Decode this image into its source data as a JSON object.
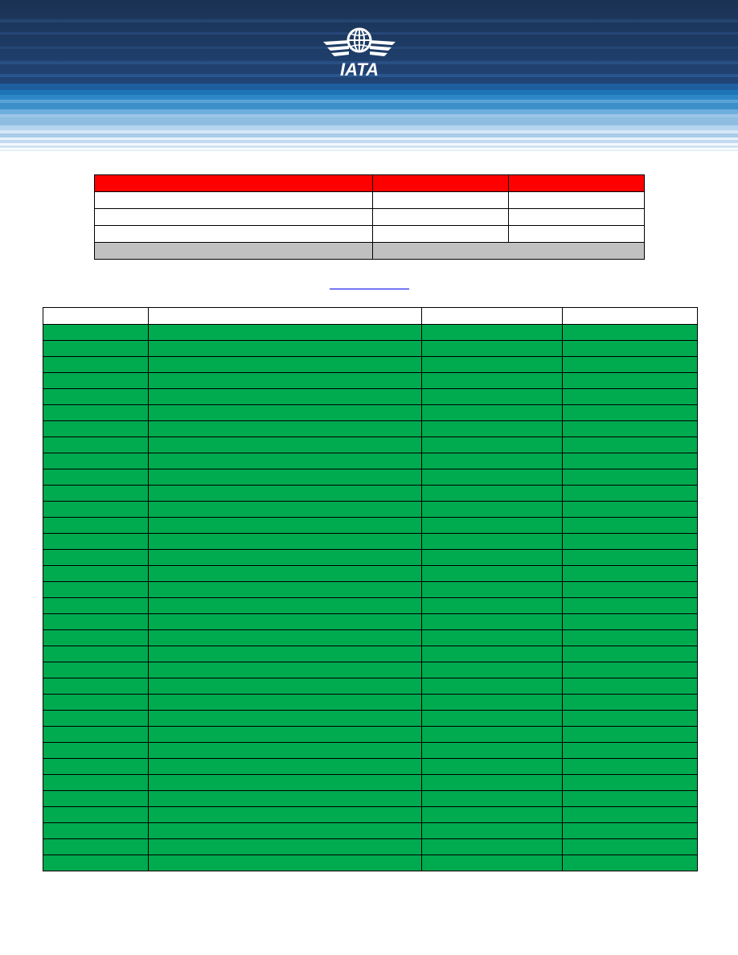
{
  "document": {
    "logo": {
      "icon": "iata-logo-icon",
      "wordmark": "IATA"
    },
    "colors": {
      "summary_header": "#ff0000",
      "summary_footer": "#c0c0c0",
      "data_rows": "#00aa4f",
      "banner": "#1d3a62"
    },
    "summary_table": {
      "header": [
        "",
        "",
        ""
      ],
      "rows": [
        [
          "",
          "",
          ""
        ],
        [
          "",
          "",
          ""
        ],
        [
          "",
          "",
          ""
        ]
      ],
      "footer": [
        "",
        ""
      ]
    },
    "link": {
      "text": ""
    },
    "main_table": {
      "columns": [
        "",
        "",
        "",
        ""
      ],
      "row_count": 34
    }
  }
}
